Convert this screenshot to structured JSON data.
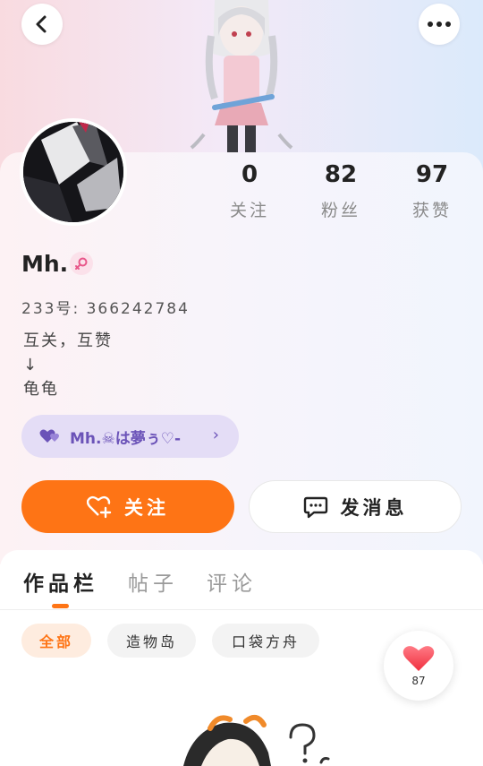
{
  "header": {
    "back_icon": "chevron-left-icon",
    "more_icon": "more-dots-icon"
  },
  "profile": {
    "name": "Mh.",
    "gender_icon": "female-gender-icon",
    "uid": "233号: 366242784",
    "bio": "互关，互赞\n↓\n龟龟"
  },
  "stats": [
    {
      "value": "0",
      "label": "关注"
    },
    {
      "value": "82",
      "label": "粉丝"
    },
    {
      "value": "97",
      "label": "获赞"
    }
  ],
  "fan_badge": {
    "text": "Mh.☠は夢ぅ♡-",
    "icon": "hearts-icon"
  },
  "actions": {
    "follow_label": "关注",
    "message_label": "发消息"
  },
  "tabs": [
    {
      "label": "作品栏"
    },
    {
      "label": "帖子"
    },
    {
      "label": "评论"
    }
  ],
  "filters": [
    {
      "label": "全部"
    },
    {
      "label": "造物岛"
    },
    {
      "label": "口袋方舟"
    }
  ],
  "like_widget": {
    "count": "87"
  },
  "colors": {
    "accent": "#fe7415",
    "badge_bg": "#e4ddf6",
    "badge_text": "#6b53b8"
  }
}
